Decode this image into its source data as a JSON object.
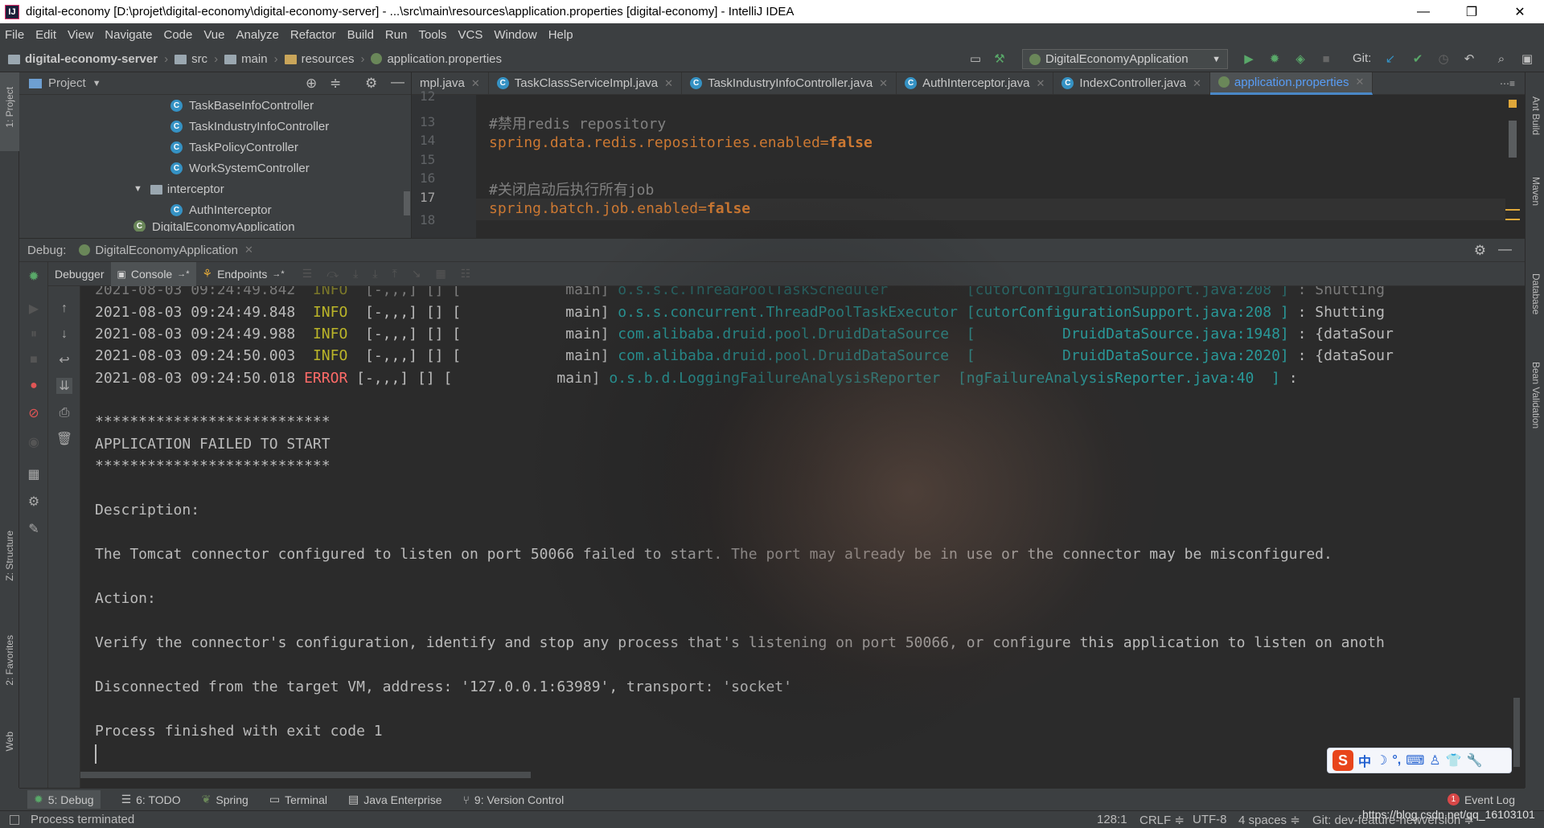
{
  "titlebar": {
    "title": "digital-economy [D:\\projet\\digital-economy\\digital-economy-server] - ...\\src\\main\\resources\\application.properties [digital-economy] - IntelliJ IDEA",
    "minimize": "—",
    "restore": "❐",
    "close": "✕"
  },
  "menu": [
    "File",
    "Edit",
    "View",
    "Navigate",
    "Code",
    "Vue",
    "Analyze",
    "Refactor",
    "Build",
    "Run",
    "Tools",
    "VCS",
    "Window",
    "Help"
  ],
  "navbar": {
    "project": "digital-economy-server",
    "crumbs": [
      "src",
      "main",
      "resources",
      "application.properties"
    ],
    "run_config": "DigitalEconomyApplication",
    "git_label": "Git:"
  },
  "project_panel": {
    "title": "Project",
    "items": [
      "TaskBaseInfoController",
      "TaskIndustryInfoController",
      "TaskPolicyController",
      "WorkSystemController",
      "interceptor",
      "AuthInterceptor",
      "DigitalEconomyApplication"
    ]
  },
  "editor": {
    "tabs": [
      "mpl.java",
      "TaskClassServiceImpl.java",
      "TaskIndustryInfoController.java",
      "AuthInterceptor.java",
      "IndexController.java",
      "application.properties"
    ],
    "line_numbers": [
      "12",
      "13",
      "14",
      "15",
      "16",
      "17",
      "18"
    ],
    "lines": {
      "l13_comment": "#禁用redis repository",
      "l14_key": "spring.data.redis.repositories.enabled=",
      "l14_val": "false",
      "l16_comment": "#关闭启动后执行所有job",
      "l17_key": "spring.batch.job.enabled=",
      "l17_val": "false"
    }
  },
  "debug": {
    "label": "Debug:",
    "session": "DigitalEconomyApplication",
    "tabs": [
      "Debugger",
      "Console",
      "Endpoints"
    ]
  },
  "console": {
    "log_rows": [
      {
        "ts": "2021-08-03 09:24:49.842",
        "level": "INFO",
        "ctx": "[-,,,] [] [",
        "thread": "main]",
        "cls": "o.s.s.c.ThreadPoolTaskScheduler",
        "loc": "[cutorConfigurationSupport.java:208 ]",
        "msg": ": Shutting"
      },
      {
        "ts": "2021-08-03 09:24:49.848",
        "level": "INFO",
        "ctx": "[-,,,] [] [",
        "thread": "main]",
        "cls": "o.s.s.concurrent.ThreadPoolTaskExecutor",
        "loc": "[cutorConfigurationSupport.java:208 ]",
        "msg": ": Shutting"
      },
      {
        "ts": "2021-08-03 09:24:49.988",
        "level": "INFO",
        "ctx": "[-,,,] [] [",
        "thread": "main]",
        "cls": "com.alibaba.druid.pool.DruidDataSource",
        "loc": "[          DruidDataSource.java:1948]",
        "msg": ": {dataSour"
      },
      {
        "ts": "2021-08-03 09:24:50.003",
        "level": "INFO",
        "ctx": "[-,,,] [] [",
        "thread": "main]",
        "cls": "com.alibaba.druid.pool.DruidDataSource",
        "loc": "[          DruidDataSource.java:2020]",
        "msg": ": {dataSour"
      },
      {
        "ts": "2021-08-03 09:24:50.018",
        "level": "ERROR",
        "ctx": "[-,,,] [] [",
        "thread": "main]",
        "cls": "o.s.b.d.LoggingFailureAnalysisReporter",
        "loc": "[ngFailureAnalysisReporter.java:40  ]",
        "msg": ":"
      }
    ],
    "stars": "***************************",
    "failed_title": "APPLICATION FAILED TO START",
    "description_label": "Description:",
    "description": "The Tomcat connector configured to listen on port 50066 failed to start. The port may already be in use or the connector may be misconfigured.",
    "action_label": "Action:",
    "action": "Verify the connector's configuration, identify and stop any process that's listening on port 50066, or configure this application to listen on anoth",
    "disconnected": "Disconnected from the target VM, address: '127.0.0.1:63989', transport: 'socket'",
    "finished": "Process finished with exit code 1"
  },
  "bottom_tabs": [
    "5: Debug",
    "6: TODO",
    "Spring",
    "Terminal",
    "Java Enterprise",
    "9: Version Control"
  ],
  "event_log": "Event Log",
  "event_count": "1",
  "status": {
    "left": "Process terminated",
    "position": "128:1",
    "line_sep": "CRLF ≑",
    "encoding": "UTF-8",
    "indent": "4 spaces ≑",
    "git": "Git: dev-feature-newversion ≑",
    "watermark": "https://blog.csdn.net/qq_16103101"
  },
  "left_strip": [
    "1: Project",
    "Z: Structure",
    "2: Favorites",
    "Web"
  ],
  "right_strip": [
    "Ant Build",
    "Maven",
    "Database",
    "Bean Validation"
  ],
  "ime": [
    "中",
    "☽",
    "°,",
    "⌨",
    "♙",
    "👕",
    "🔧"
  ]
}
